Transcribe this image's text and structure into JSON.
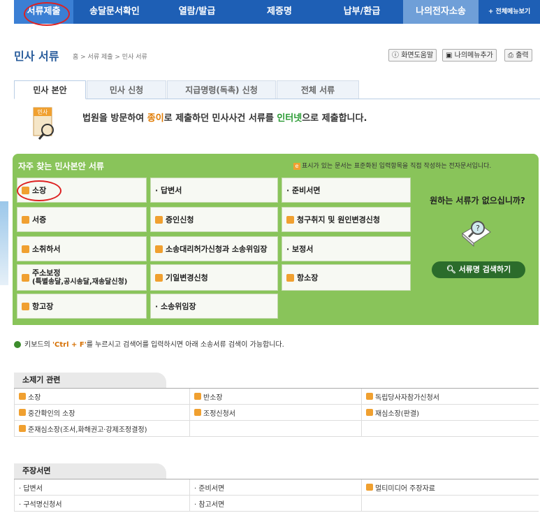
{
  "nav": {
    "items": [
      "서류제출",
      "송달문서확인",
      "열람/발급",
      "제증명",
      "납부/환급",
      "나의전자소송"
    ],
    "all_menu": "+ 전체메뉴보기"
  },
  "header": {
    "title": "민사 서류",
    "breadcrumb": "홈 > 서류 제출 > 민사 서류",
    "help": "화면도움말",
    "add_menu": "나의메뉴추가",
    "print": "출력"
  },
  "tabs": [
    "민사 본안",
    "민사 신청",
    "지급명령(독촉) 신청",
    "전체 서류"
  ],
  "intro": {
    "icon_label": "민사",
    "p1": "법원을 방문하여 ",
    "h1": "종이",
    "p2": "로 제출하던 민사사건 서류를 ",
    "h2": "인터넷",
    "p3": "으로 제출합니다."
  },
  "frequent": {
    "title": "자주 찾는 민사본안 서류",
    "note": "표시가 있는 문서는 표준화된 입력항목을 직접 작성하는 전자문서입니다.",
    "cells": [
      {
        "label": "소장",
        "e": true
      },
      {
        "label": "· 답변서",
        "e": false
      },
      {
        "label": "· 준비서면",
        "e": false
      },
      {
        "label": "서증",
        "e": true
      },
      {
        "label": "증인신청",
        "e": true
      },
      {
        "label": "청구취지 및 원인변경신청",
        "e": true
      },
      {
        "label": "소취하서",
        "e": true
      },
      {
        "label": "소송대리허가신청과 소송위임장",
        "e": true
      },
      {
        "label": "· 보정서",
        "e": false
      },
      {
        "label": "주소보정",
        "sub": "(특별송달,공시송달,재송달신청)",
        "e": true
      },
      {
        "label": "기일변경신청",
        "e": true
      },
      {
        "label": "항소장",
        "e": true
      },
      {
        "label": "항고장",
        "e": true
      },
      {
        "label": "· 소송위임장",
        "e": false
      }
    ],
    "question": "원하는 서류가 없으십니까?",
    "search_btn": "서류명 검색하기"
  },
  "hint": {
    "pre": "키보드의 ",
    "key": "'Ctrl + F'",
    "post": "를 누르시고 검색어를 입력하시면 아래 소송서류 검색이 가능합니다."
  },
  "cat1": {
    "title": "소제기 관련",
    "rows": [
      [
        {
          "t": "소장",
          "e": true
        },
        {
          "t": "반소장",
          "e": true
        },
        {
          "t": "독립당사자참가신청서",
          "e": true
        }
      ],
      [
        {
          "t": "중간확인의 소장",
          "e": true
        },
        {
          "t": "조정신청서",
          "e": true
        },
        {
          "t": "재심소장(판결)",
          "e": true
        }
      ],
      [
        {
          "t": "준재심소장(조서,화해권고·강제조정결정)",
          "e": true
        },
        {
          "t": "",
          "e": false
        },
        {
          "t": "",
          "e": false
        }
      ]
    ]
  },
  "cat2": {
    "title": "주장서면",
    "rows": [
      [
        {
          "t": "· 답변서",
          "e": false
        },
        {
          "t": "· 준비서면",
          "e": false
        },
        {
          "t": "멀티미디어 주장자료",
          "e": true
        }
      ],
      [
        {
          "t": "· 구석명신청서",
          "e": false
        },
        {
          "t": "· 참고서면",
          "e": false
        },
        {
          "t": "",
          "e": false
        }
      ]
    ]
  },
  "colors": {
    "nav": "#1e5fb5",
    "green": "#89c45a",
    "title": "#2a5d9c"
  }
}
